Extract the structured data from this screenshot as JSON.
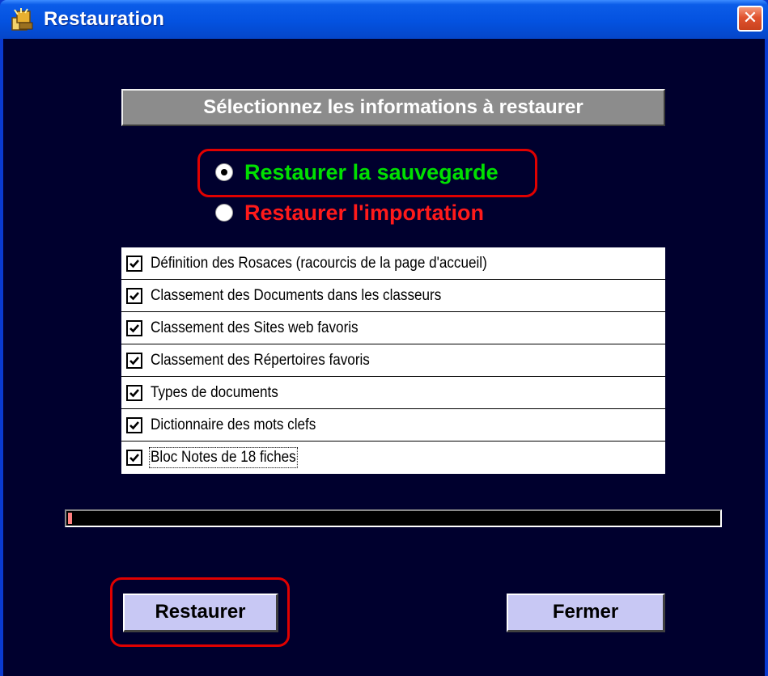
{
  "window": {
    "title": "Restauration",
    "close_symbol": "✕"
  },
  "header": {
    "text": "Sélectionnez les informations à restaurer"
  },
  "restore_mode": {
    "options": [
      {
        "label": "Restaurer la sauvegarde",
        "checked": true,
        "color": "#00e000"
      },
      {
        "label": "Restaurer l'importation",
        "checked": false,
        "color": "#ff1a1a"
      }
    ]
  },
  "items": [
    {
      "label": "Définition des Rosaces (racourcis de la page d'accueil)",
      "checked": true
    },
    {
      "label": "Classement des Documents dans les classeurs",
      "checked": true
    },
    {
      "label": "Classement des Sites web favoris",
      "checked": true
    },
    {
      "label": "Classement des Répertoires favoris",
      "checked": true
    },
    {
      "label": "Types de documents",
      "checked": true
    },
    {
      "label": "Dictionnaire des mots clefs",
      "checked": true
    },
    {
      "label": "Bloc Notes de 18 fiches",
      "checked": true
    }
  ],
  "progress": {
    "fraction": 0.006,
    "fill_color": "#ff8080"
  },
  "buttons": {
    "restore_label": "Restaurer",
    "close_label": "Fermer"
  },
  "highlight_color": "#e00000"
}
